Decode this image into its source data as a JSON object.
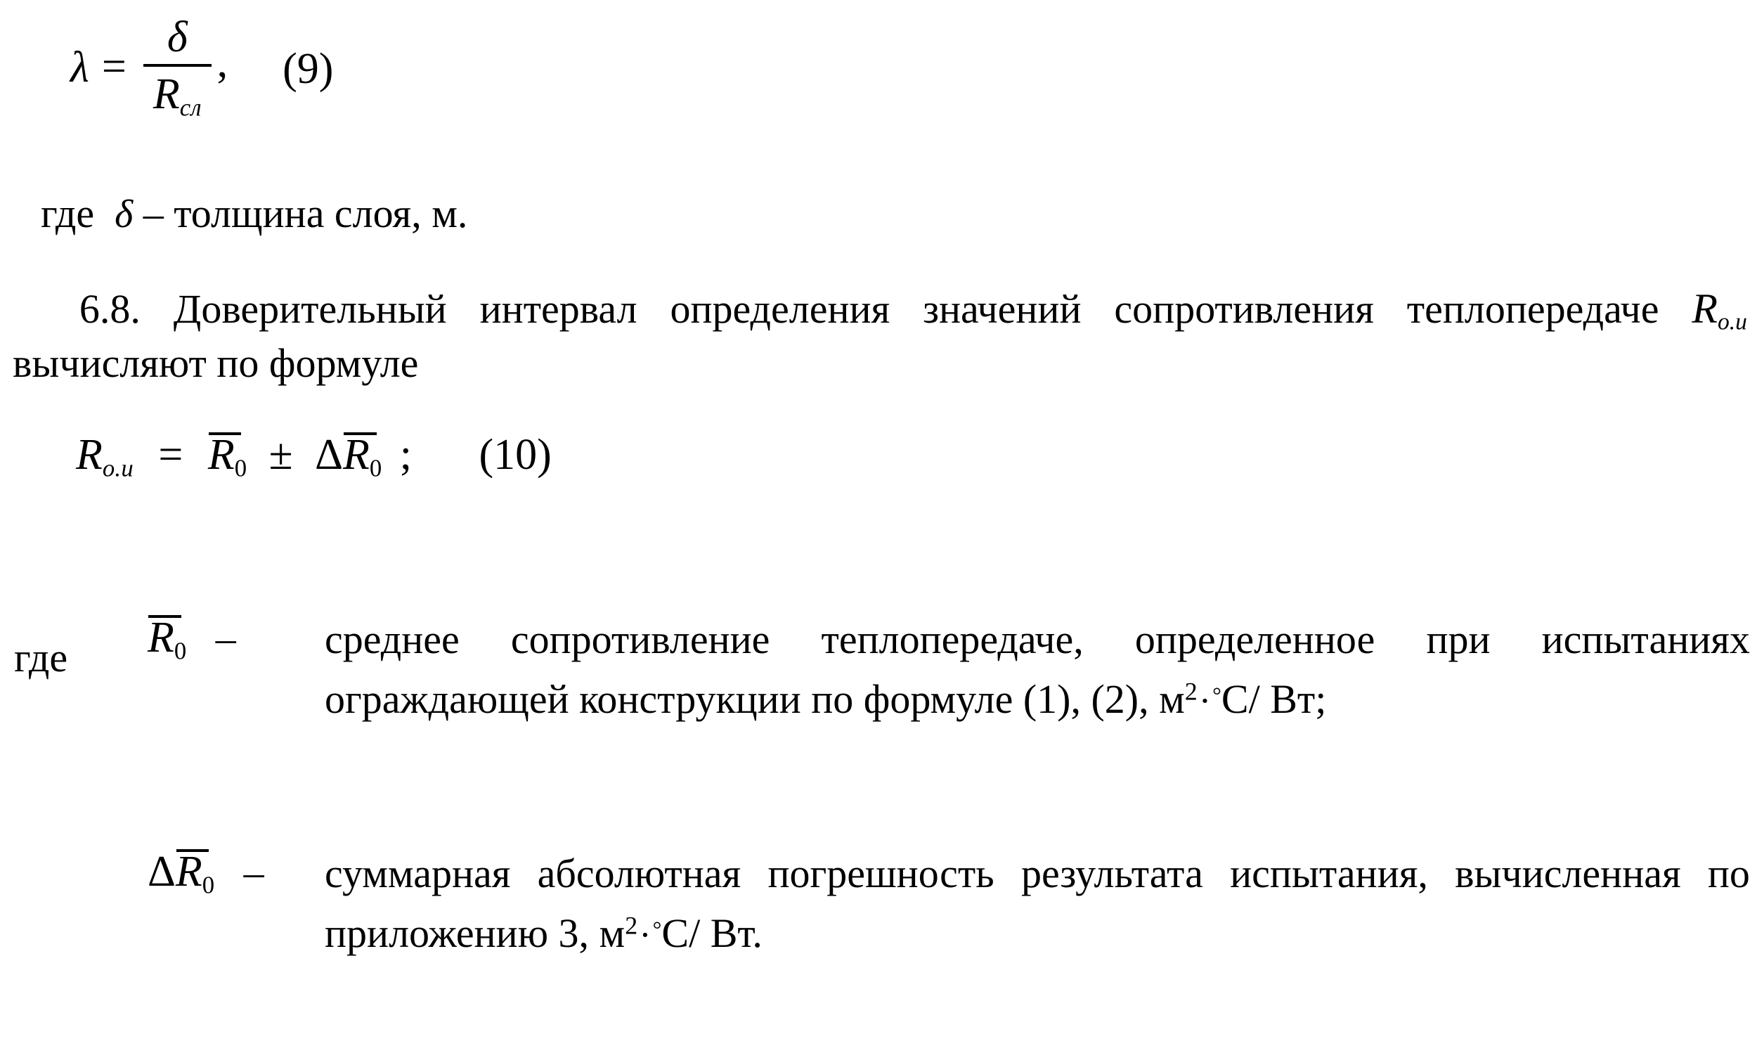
{
  "document": {
    "language": "ru",
    "background_color": "#ffffff",
    "text_color": "#000000"
  },
  "formula_9": {
    "lhs": "λ",
    "equals": "=",
    "numerator": "δ",
    "denominator": "R",
    "denominator_subscript": "сл",
    "trailing_punctuation": ",",
    "number": "(9)"
  },
  "where_delta_line": {
    "prefix": "где",
    "symbol": "δ",
    "dash": "–",
    "description": "толщина слоя, м."
  },
  "clause_6_8": {
    "number": "6.8.",
    "line1_words": [
      "Доверительный",
      "интервал",
      "определения",
      "значений",
      "сопротивления",
      "теплопередаче"
    ],
    "line1_symbol": "R",
    "line1_symbol_subscript": "о.и",
    "line2": "вычисляют по формуле"
  },
  "formula_10": {
    "lhs": "R",
    "lhs_subscript": "о.и",
    "equals": "=",
    "mean_symbol": "R",
    "mean_subscript": "0",
    "plus_minus": "±",
    "delta": "Δ",
    "delta_symbol": "R",
    "delta_subscript": "0",
    "trailing_punctuation": ";",
    "number": "(10)"
  },
  "definitions": [
    {
      "lead_label": "где",
      "symbol_delta": "",
      "symbol": "R",
      "symbol_subscript": "0",
      "symbol_overbar": true,
      "dash": "–",
      "line1_words": [
        "среднее",
        "сопротивление",
        "теплопередаче,",
        "определенное",
        "при",
        "испытаниях"
      ],
      "line2_text": "ограждающей конструкции по формуле (1), (2), м",
      "line2_unit_exponent": "2",
      "line2_unit_dot": "·",
      "line2_unit_degree": "°",
      "line2_unit_celsius": "С",
      "line2_unit_slash": "/",
      "line2_unit_watt": "Вт;"
    },
    {
      "lead_label": "",
      "symbol_delta": "Δ",
      "symbol": "R",
      "symbol_subscript": "0",
      "symbol_overbar": true,
      "dash": "–",
      "line1_words": [
        "суммарная",
        "абсолютная",
        "погрешность",
        "результата",
        "испытания,",
        "вычисленная",
        "по"
      ],
      "line2_text": "приложению 3, м",
      "line2_unit_exponent": "2",
      "line2_unit_dot": "·",
      "line2_unit_degree": "°",
      "line2_unit_celsius": "С",
      "line2_unit_slash": "/",
      "line2_unit_watt": "Вт."
    }
  ]
}
